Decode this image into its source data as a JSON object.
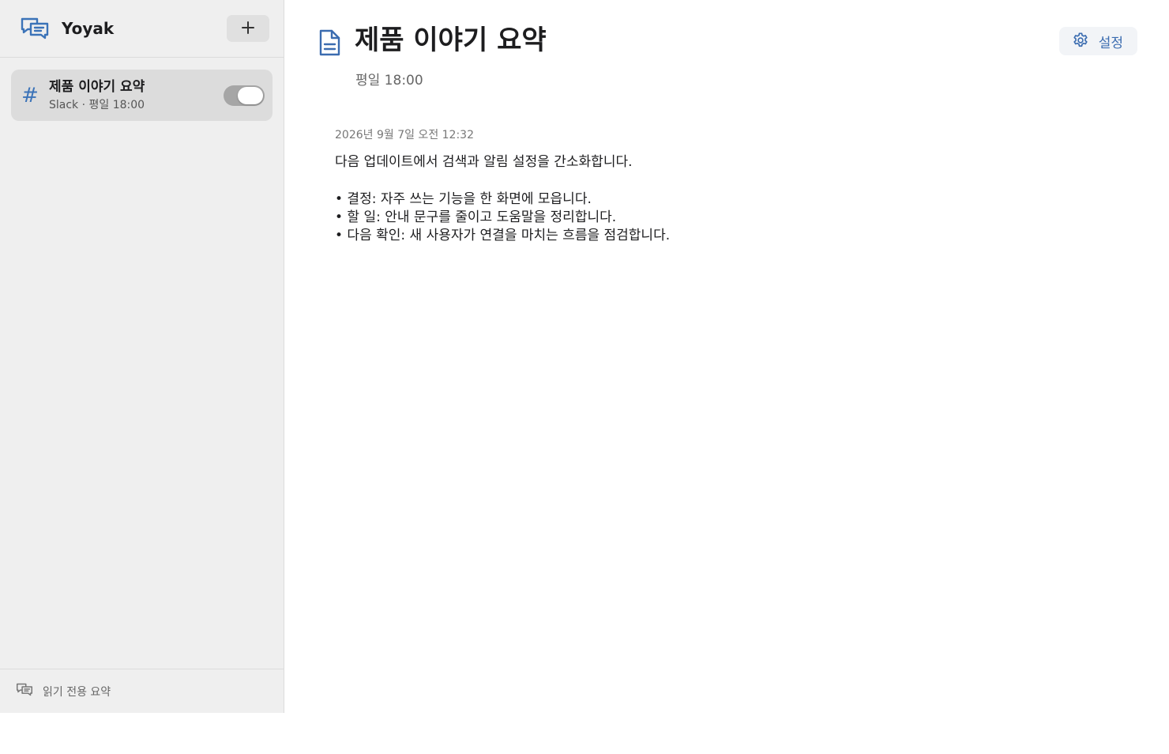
{
  "app": {
    "name": "Yoyak",
    "logo_icon": "chat-bubbles-icon",
    "add_icon": "plus-icon"
  },
  "sidebar": {
    "items": [
      {
        "title": "제품 이야기 요약",
        "subtitle": "Slack · 평일 18:00",
        "icon": "hash-icon",
        "icon_glyph": "#",
        "enabled": true
      }
    ],
    "footer": {
      "label": "읽기 전용 요약",
      "icon": "chat-bubbles-icon"
    }
  },
  "main": {
    "title": "제품 이야기 요약",
    "title_icon": "document-icon",
    "schedule": "평일 18:00",
    "settings_label": "설정",
    "settings_icon": "gear-icon",
    "summary": {
      "timestamp": "2026년 9월 7일 오전 12:32",
      "intro": "다음 업데이트에서 검색과 알림 설정을 간소화합니다.",
      "bullets": [
        "• 결정: 자주 쓰는 기능을 한 화면에 모읍니다.",
        "• 할 일: 안내 문구를 줄이고 도움말을 정리합니다.",
        "• 다음 확인: 새 사용자가 연결을 마치는 흐름을 점검합니다."
      ]
    }
  },
  "colors": {
    "accent": "#3b73b8",
    "sidebar_bg": "#efefef",
    "selected_item_bg": "#dcdcdc",
    "toggle_on": "#a6a6a6"
  }
}
